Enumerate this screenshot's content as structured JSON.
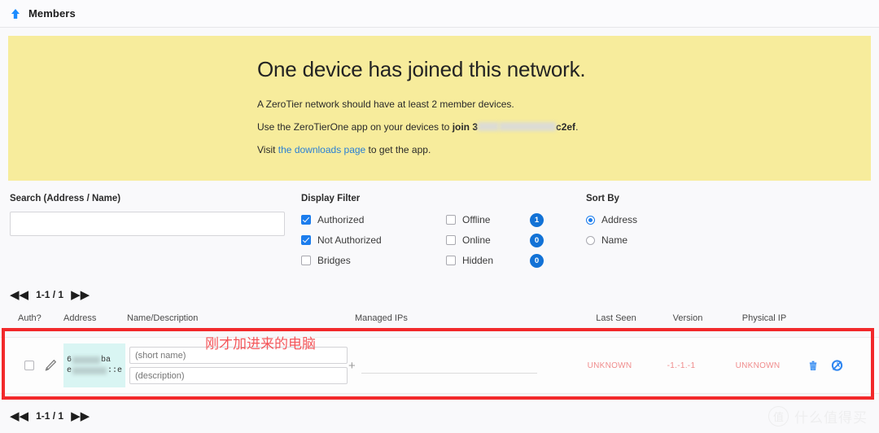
{
  "header": {
    "title": "Members",
    "icon": "up-arrow-icon"
  },
  "banner": {
    "heading": "One device has joined this network.",
    "line1": "A ZeroTier network should have at least 2 member devices.",
    "line2_prefix": "Use the ZeroTierOne app on your devices to ",
    "line2_join": "join 3",
    "line2_suffix": "c2ef",
    "line2_end": ".",
    "line3_prefix": "Visit ",
    "line3_link": "the downloads page",
    "line3_suffix": " to get the app.",
    "bg_color": "#f7ec9c"
  },
  "search": {
    "label": "Search (Address / Name)",
    "value": "",
    "placeholder": ""
  },
  "display_filter": {
    "label": "Display Filter",
    "left_items": [
      {
        "label": "Authorized",
        "checked": true
      },
      {
        "label": "Not Authorized",
        "checked": true
      },
      {
        "label": "Bridges",
        "checked": false
      }
    ],
    "right_items": [
      {
        "label": "Offline",
        "checked": false,
        "count": "1"
      },
      {
        "label": "Online",
        "checked": false,
        "count": "0"
      },
      {
        "label": "Hidden",
        "checked": false,
        "count": "0"
      }
    ],
    "badge_color": "#1272d6"
  },
  "sort_by": {
    "label": "Sort By",
    "options": [
      {
        "label": "Address",
        "selected": true
      },
      {
        "label": "Name",
        "selected": false
      }
    ]
  },
  "pagination": {
    "first_icon": "double-left-arrow-icon",
    "last_icon": "double-right-arrow-icon",
    "range": "1-1 / 1"
  },
  "table": {
    "columns": {
      "auth": "Auth?",
      "address": "Address",
      "name": "Name/Description",
      "ips": "Managed IPs",
      "last_seen": "Last Seen",
      "version": "Version",
      "physical_ip": "Physical IP"
    },
    "rows": [
      {
        "authorized": false,
        "address_line1_start": "6",
        "address_line1_end": "ba",
        "address_line2_start": "e",
        "address_line2_end": "::e",
        "short_name_placeholder": "(short name)",
        "short_name_value": "",
        "description_placeholder": "(description)",
        "description_value": "",
        "managed_ip_value": "",
        "last_seen": "UNKNOWN",
        "version": "-1.-1.-1",
        "physical_ip": "UNKNOWN",
        "delete_icon": "trash-icon",
        "toggle_icon": "circle-arrow-icon"
      }
    ]
  },
  "annotation": {
    "text": "刚才加进来的电脑",
    "color": "#f4565a",
    "box_color": "#f2292b"
  },
  "watermark": {
    "mark": "值",
    "text": "什么值得买"
  }
}
